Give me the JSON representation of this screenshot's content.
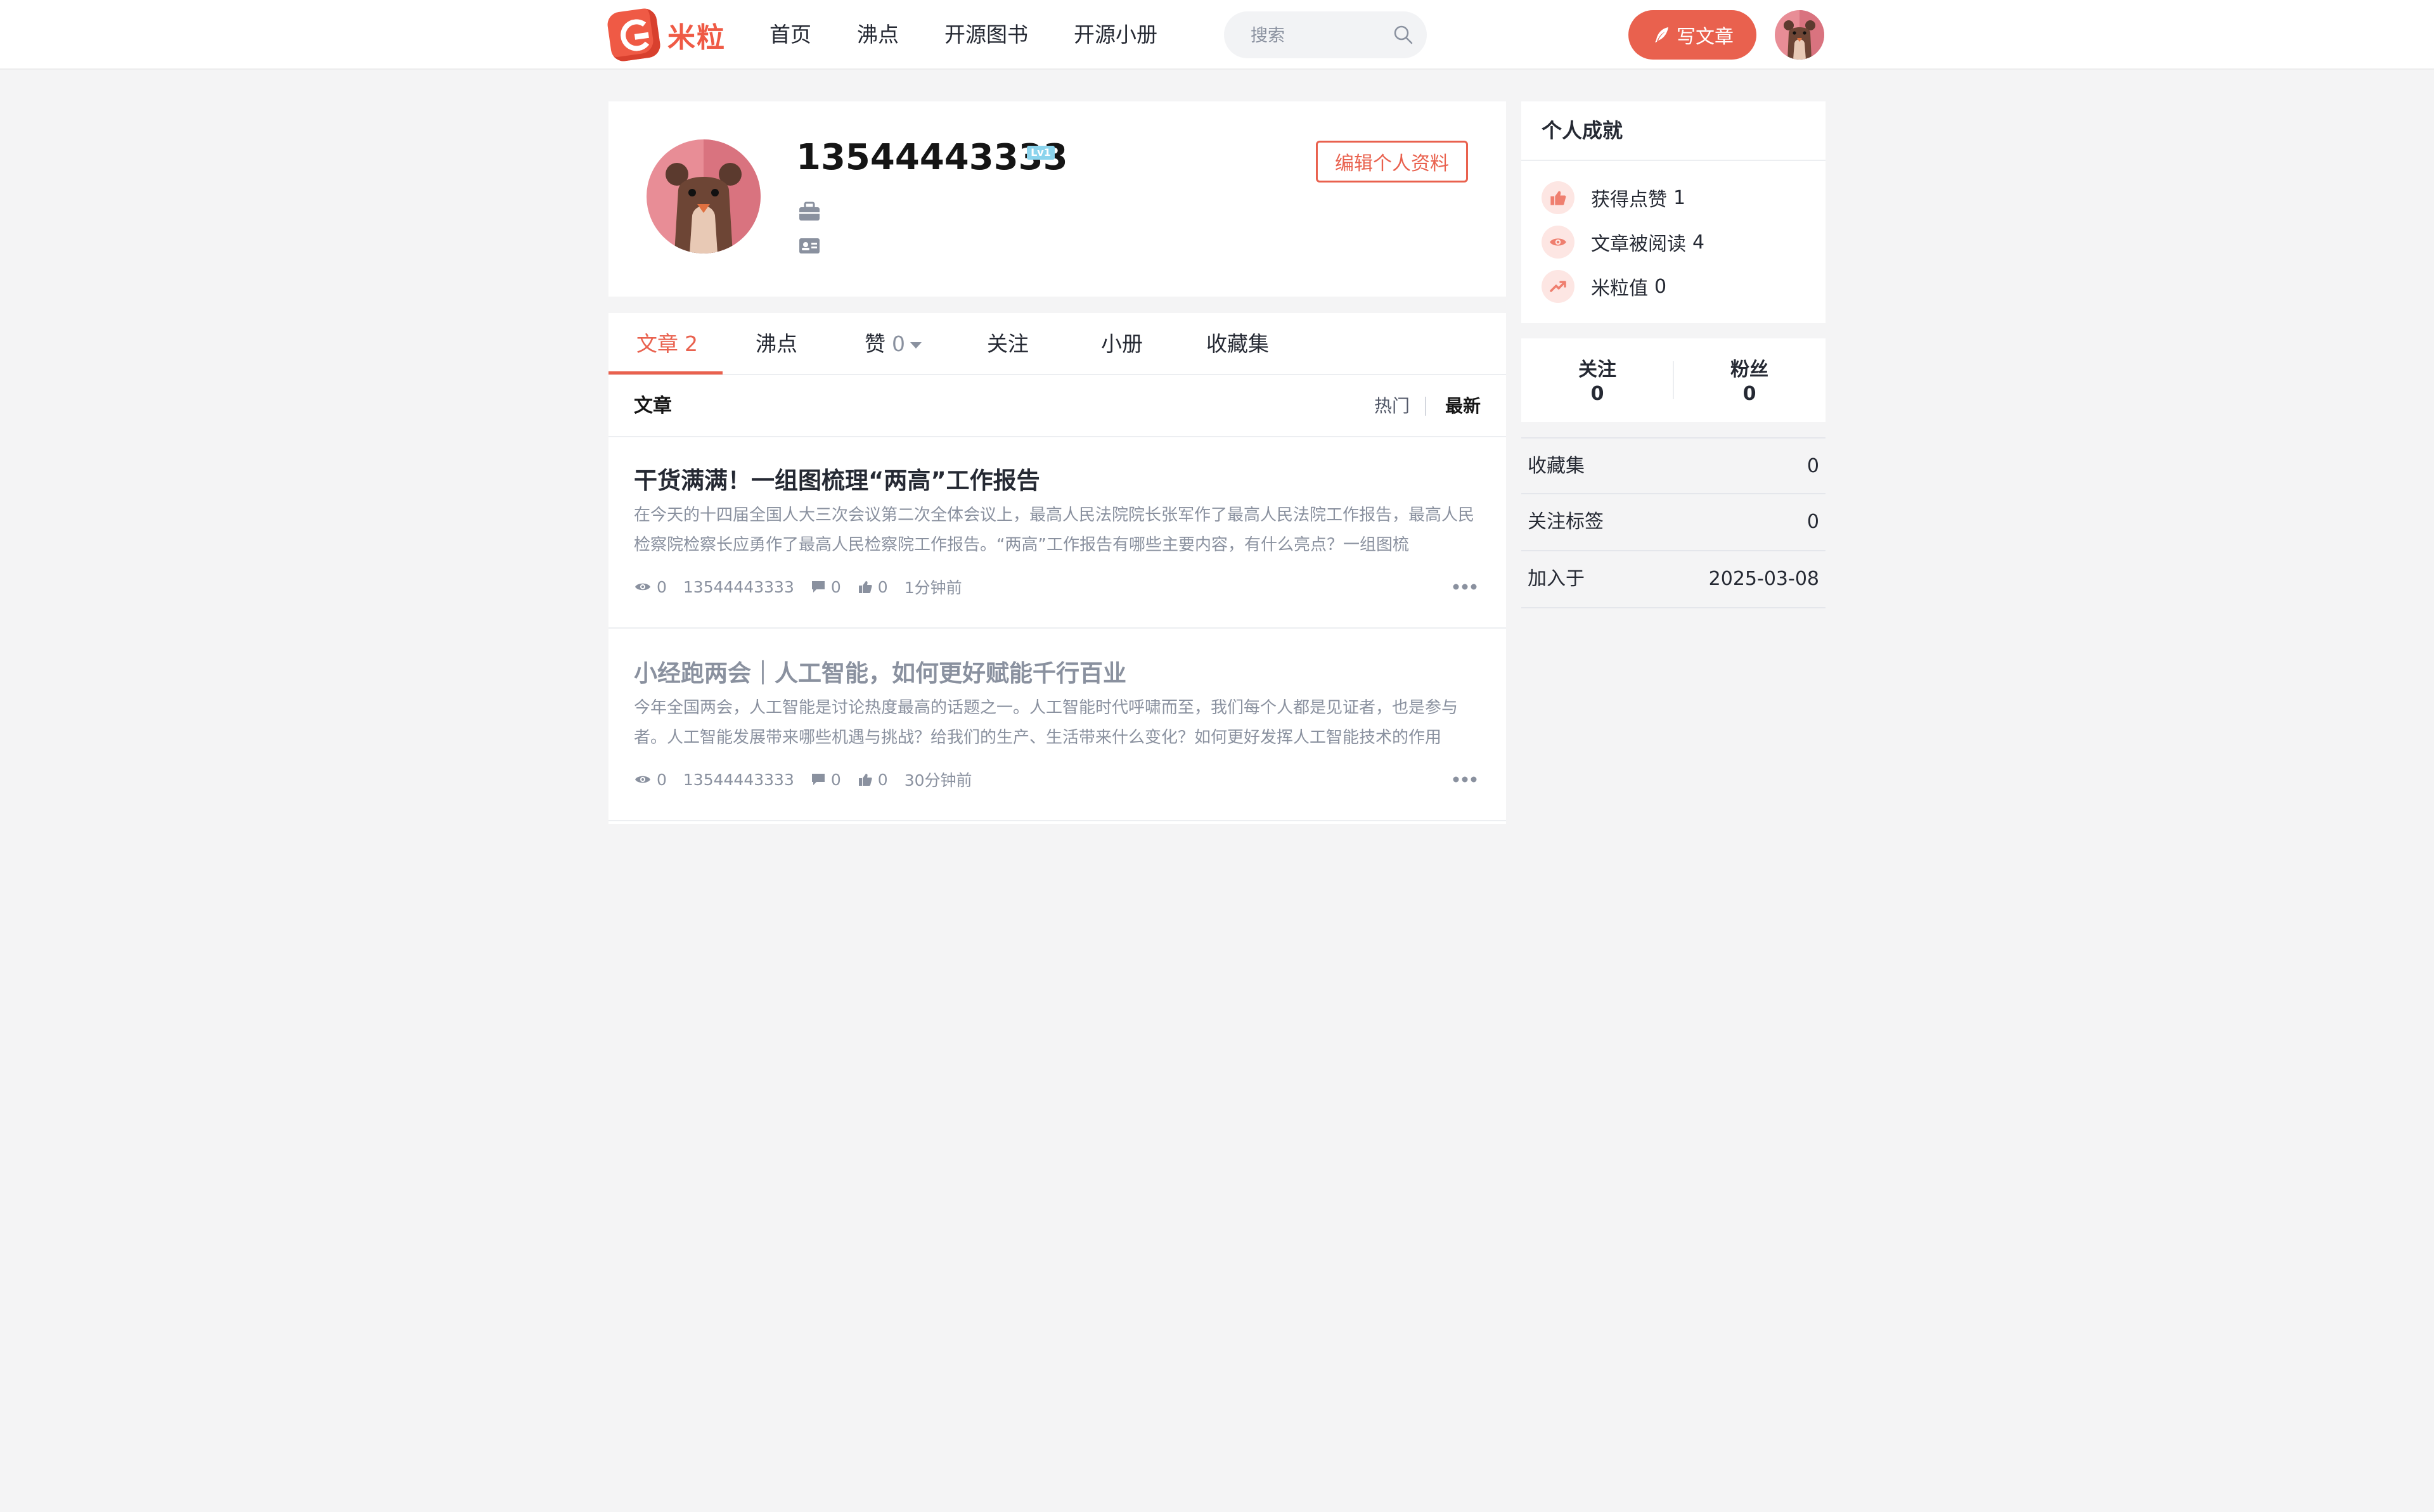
{
  "header": {
    "logo_text": "米粒",
    "nav": [
      "首页",
      "沸点",
      "开源图书",
      "开源小册"
    ],
    "search_placeholder": "搜索",
    "write_button": "写文章"
  },
  "profile": {
    "username": "13544443333",
    "level": "Lv1",
    "edit_button": "编辑个人资料"
  },
  "tabs": [
    {
      "label": "文章",
      "count": "2"
    },
    {
      "label": "沸点",
      "count": ""
    },
    {
      "label": "赞",
      "count": "0"
    },
    {
      "label": "关注",
      "count": ""
    },
    {
      "label": "小册",
      "count": ""
    },
    {
      "label": "收藏集",
      "count": ""
    }
  ],
  "list": {
    "title": "文章",
    "sort_hot": "热门",
    "sort_new": "最新"
  },
  "articles": [
    {
      "title": "干货满满！一组图梳理“两高”工作报告",
      "abstract": "在今天的十四届全国人大三次会议第二次全体会议上，最高人民法院院长张军作了最高人民法院工作报告，最高人民检察院检察长应勇作了最高人民检察院工作报告。“两高”工作报告有哪些主要内容，有什么亮点？一组图梳",
      "views": "0",
      "author": "13544443333",
      "comments": "0",
      "likes": "0",
      "time": "1分钟前"
    },
    {
      "title": "小经跑两会｜人工智能，如何更好赋能千行百业",
      "abstract": "今年全国两会，人工智能是讨论热度最高的话题之一。人工智能时代呼啸而至，我们每个人都是见证者，也是参与者。人工智能发展带来哪些机遇与挑战？给我们的生产、生活带来什么变化？如何更好发挥人工智能技术的作用",
      "views": "0",
      "author": "13544443333",
      "comments": "0",
      "likes": "0",
      "time": "30分钟前"
    }
  ],
  "achievements": {
    "title": "个人成就",
    "items": [
      {
        "label": "获得点赞",
        "value": "1",
        "icon": "thumb-up-icon"
      },
      {
        "label": "文章被阅读",
        "value": "4",
        "icon": "eye-icon"
      },
      {
        "label": "米粒值",
        "value": "0",
        "icon": "trend-icon"
      }
    ]
  },
  "follow": {
    "following_label": "关注",
    "following_count": "0",
    "followers_label": "粉丝",
    "followers_count": "0"
  },
  "stats": [
    {
      "label": "收藏集",
      "value": "0"
    },
    {
      "label": "关注标签",
      "value": "0"
    },
    {
      "label": "加入于",
      "value": "2025-03-08"
    }
  ],
  "colors": {
    "accent": "#e9614e",
    "background": "#f4f4f5",
    "level_badge": "#8bd4ed"
  }
}
